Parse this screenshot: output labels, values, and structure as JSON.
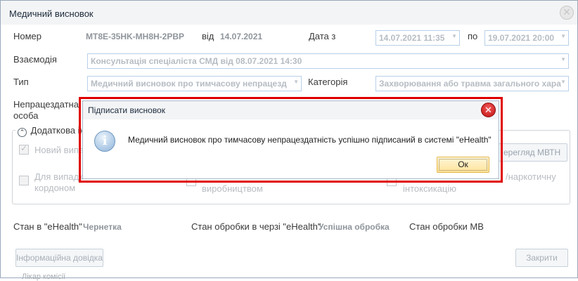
{
  "window": {
    "title": "Медичний висновок"
  },
  "header": {
    "number_label": "Номер",
    "number_value": "MT8E-35HK-MH8H-2PBP",
    "from_label": "від",
    "from_value": "14.07.2021",
    "date_label": "Дата з",
    "date_from": "14.07.2021 11:35",
    "to_label": "по",
    "date_to": "19.07.2021 20:00"
  },
  "form": {
    "interaction_label": "Взаємодія",
    "interaction_value": "Консультація спеціаліста СМД від 08.07.2021 14:30",
    "type_label": "Тип",
    "type_value": "Медичний висновок про тимчасову непрацезд",
    "category_label": "Категорія",
    "category_value": "Захворювання або травма загального хара",
    "disabled_person_label_1": "Непрацездатна",
    "disabled_person_label_2": "особа"
  },
  "additional": {
    "section_label": "Додаткова ін",
    "new_case_label": "Новий випа",
    "border_label_1": "Для випадк",
    "border_label_2": "кордоном",
    "production_label": "виробництвом",
    "narcotic_label": "/наркотичну",
    "intoxication_label": "інтоксикацію",
    "view_button": "ерегляд МВТН"
  },
  "status": {
    "ehealth_label": "Стан в \"eHealth\"",
    "ehealth_value": "Чернетка",
    "queue_label": "Стан обробки в черзі \"eHealth\"",
    "queue_value": "Успішна обробка",
    "mv_label": "Стан обробки МВ"
  },
  "footer": {
    "info_button": "Інформаційна довідка",
    "close_button": "Закрити",
    "cut_text": "Лікар   комісії"
  },
  "dialog": {
    "title": "Підписати висновок",
    "message": "Медичний висновок про тимчасову непрацездатність успішно підписаний в системі \"eHealth\"",
    "ok_label": "Ок"
  },
  "colors": {
    "highlight_frame": "#e00000",
    "ok_button": "#ffe39a",
    "close_red": "#c21010"
  }
}
